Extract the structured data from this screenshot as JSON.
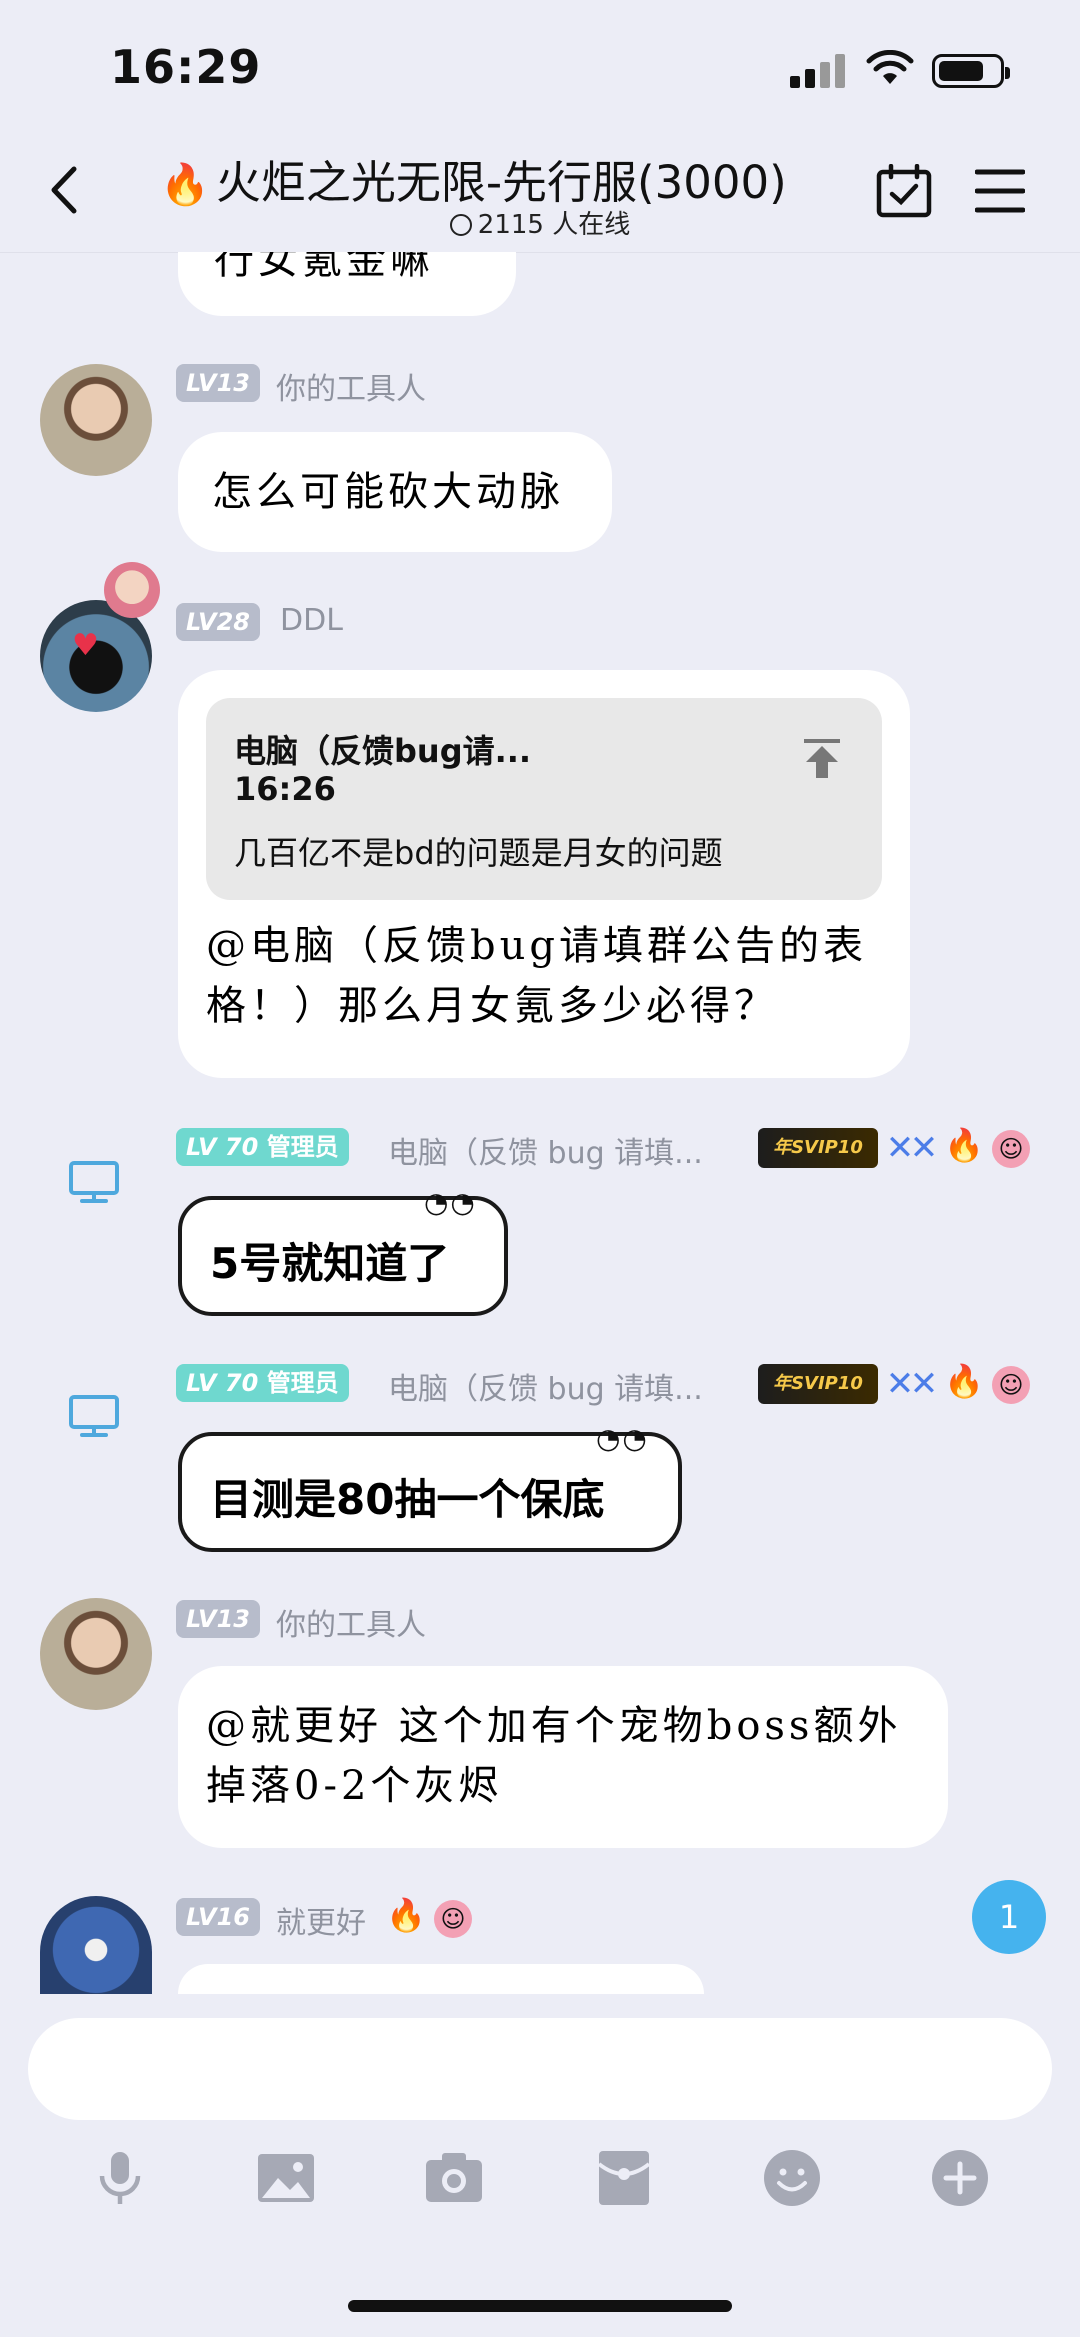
{
  "status_bar": {
    "time": "16:29"
  },
  "header": {
    "title": "火炬之光无限-先行服(3000)",
    "online": "2115 人在线"
  },
  "messages": [
    {
      "type": "partial",
      "text": "行女氪金嘛"
    },
    {
      "level": "LV13",
      "nickname": "你的工具人",
      "text": "怎么可能砍大动脉"
    },
    {
      "level": "LV28",
      "nickname": "DDL",
      "quote": {
        "author": "电脑（反馈bug请...",
        "time": "16:26",
        "text": "几百亿不是bd的问题是月女的问题"
      },
      "text_line1": "@电脑（反馈bug请填群公告的表",
      "text_line2": "格！）那么月女氪多少必得？"
    },
    {
      "level": "LV 70",
      "role": "管理员",
      "nickname": "电脑（反馈 bug 请填...",
      "text": "5号就知道了",
      "svip": "年SVIP10"
    },
    {
      "level": "LV 70",
      "role": "管理员",
      "nickname": "电脑（反馈 bug 请填...",
      "text": "目测是80抽一个保底",
      "svip": "年SVIP10"
    },
    {
      "level": "LV13",
      "nickname": "你的工具人",
      "text_line1": "@就更好 这个加有个宠物boss额外",
      "text_line2": "掉落0-2个灰烬"
    },
    {
      "level": "LV16",
      "nickname": "就更好"
    }
  ],
  "unread_count": "1",
  "colors": {
    "background": "#ecedf6",
    "admin_badge": "#6fd8cf",
    "level_badge": "#b7bccb",
    "unread": "#45b3ee"
  },
  "toolbar_icons": [
    "microphone-icon",
    "image-icon",
    "camera-icon",
    "red-packet-icon",
    "emoji-icon",
    "plus-icon"
  ]
}
